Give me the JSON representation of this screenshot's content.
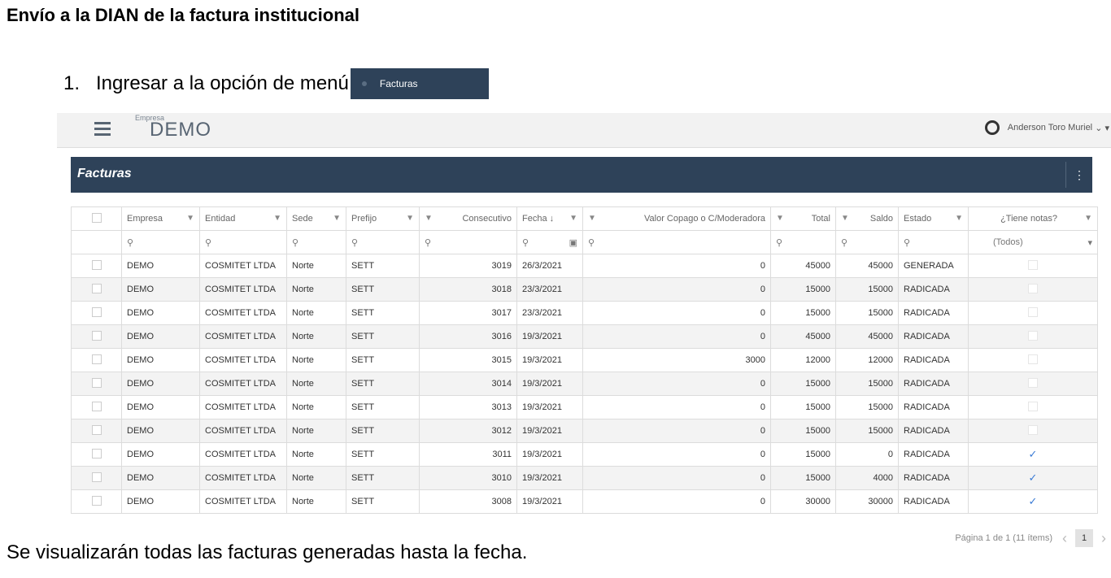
{
  "doc": {
    "title": "Envío a la DIAN de la factura institucional",
    "step_number": "1.",
    "step_text": "Ingresar a la opción de menú",
    "menu_chip_label": "Facturas",
    "footer": "Se visualizarán todas las facturas generadas hasta la fecha."
  },
  "app": {
    "brand_small": "Empresa",
    "brand_big": "DEMO",
    "user_name": "Anderson Toro Muriel",
    "panel_title": "Facturas",
    "panel_menu_icon": "⋮"
  },
  "table": {
    "headers": [
      "Empresa",
      "Entidad",
      "Sede",
      "Prefijo",
      "Consecutivo",
      "Fecha",
      "Valor Copago o C/Moderadora",
      "Total",
      "Saldo",
      "Estado",
      "¿Tiene notas?"
    ],
    "filter_select": "(Todos)",
    "rows": [
      {
        "empresa": "DEMO",
        "entidad": "COSMITET LTDA",
        "sede": "Norte",
        "prefijo": "SETT",
        "consecutivo": "3019",
        "fecha": "26/3/2021",
        "copago": "0",
        "total": "45000",
        "saldo": "45000",
        "estado": "GENERADA",
        "notas": false
      },
      {
        "empresa": "DEMO",
        "entidad": "COSMITET LTDA",
        "sede": "Norte",
        "prefijo": "SETT",
        "consecutivo": "3018",
        "fecha": "23/3/2021",
        "copago": "0",
        "total": "15000",
        "saldo": "15000",
        "estado": "RADICADA",
        "notas": false
      },
      {
        "empresa": "DEMO",
        "entidad": "COSMITET LTDA",
        "sede": "Norte",
        "prefijo": "SETT",
        "consecutivo": "3017",
        "fecha": "23/3/2021",
        "copago": "0",
        "total": "15000",
        "saldo": "15000",
        "estado": "RADICADA",
        "notas": false
      },
      {
        "empresa": "DEMO",
        "entidad": "COSMITET LTDA",
        "sede": "Norte",
        "prefijo": "SETT",
        "consecutivo": "3016",
        "fecha": "19/3/2021",
        "copago": "0",
        "total": "45000",
        "saldo": "45000",
        "estado": "RADICADA",
        "notas": false
      },
      {
        "empresa": "DEMO",
        "entidad": "COSMITET LTDA",
        "sede": "Norte",
        "prefijo": "SETT",
        "consecutivo": "3015",
        "fecha": "19/3/2021",
        "copago": "3000",
        "total": "12000",
        "saldo": "12000",
        "estado": "RADICADA",
        "notas": false
      },
      {
        "empresa": "DEMO",
        "entidad": "COSMITET LTDA",
        "sede": "Norte",
        "prefijo": "SETT",
        "consecutivo": "3014",
        "fecha": "19/3/2021",
        "copago": "0",
        "total": "15000",
        "saldo": "15000",
        "estado": "RADICADA",
        "notas": false
      },
      {
        "empresa": "DEMO",
        "entidad": "COSMITET LTDA",
        "sede": "Norte",
        "prefijo": "SETT",
        "consecutivo": "3013",
        "fecha": "19/3/2021",
        "copago": "0",
        "total": "15000",
        "saldo": "15000",
        "estado": "RADICADA",
        "notas": false
      },
      {
        "empresa": "DEMO",
        "entidad": "COSMITET LTDA",
        "sede": "Norte",
        "prefijo": "SETT",
        "consecutivo": "3012",
        "fecha": "19/3/2021",
        "copago": "0",
        "total": "15000",
        "saldo": "15000",
        "estado": "RADICADA",
        "notas": false
      },
      {
        "empresa": "DEMO",
        "entidad": "COSMITET LTDA",
        "sede": "Norte",
        "prefijo": "SETT",
        "consecutivo": "3011",
        "fecha": "19/3/2021",
        "copago": "0",
        "total": "15000",
        "saldo": "0",
        "estado": "RADICADA",
        "notas": true
      },
      {
        "empresa": "DEMO",
        "entidad": "COSMITET LTDA",
        "sede": "Norte",
        "prefijo": "SETT",
        "consecutivo": "3010",
        "fecha": "19/3/2021",
        "copago": "0",
        "total": "15000",
        "saldo": "4000",
        "estado": "RADICADA",
        "notas": true
      },
      {
        "empresa": "DEMO",
        "entidad": "COSMITET LTDA",
        "sede": "Norte",
        "prefijo": "SETT",
        "consecutivo": "3008",
        "fecha": "19/3/2021",
        "copago": "0",
        "total": "30000",
        "saldo": "30000",
        "estado": "RADICADA",
        "notas": true
      }
    ]
  },
  "pager": {
    "info": "Página 1 de 1 (11 ítems)",
    "current_page": "1"
  },
  "colors": {
    "header_bg": "#2e4259",
    "accent": "#3a7bd5"
  }
}
